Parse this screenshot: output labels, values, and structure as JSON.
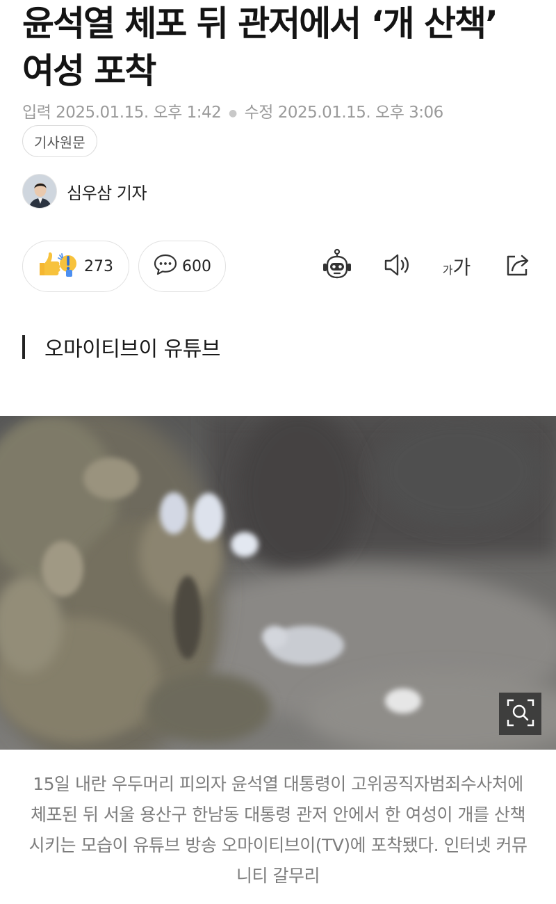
{
  "article": {
    "headline_line1": "윤석열 체포 뒤 관저에서 ‘개 산책’",
    "headline_line2": "여성 포착",
    "input_label": "입력",
    "input_time": "2025.01.15. 오후 1:42",
    "edit_label": "수정",
    "edit_time": "2025.01.15. 오후 3:06",
    "original_button": "기사원문",
    "reporter": "심우삼 기자"
  },
  "actions": {
    "reaction_count": "273",
    "comment_count": "600",
    "font_small": "가",
    "font_large": "가"
  },
  "section": {
    "label": "오마이티브이 유튜브"
  },
  "photo": {
    "caption": "15일 내란 우두머리 피의자 윤석열 대통령이 고위공직자범죄수사처에 체포된 뒤 서울 용산구 한남동 대통령 관저 안에서 한 여성이 개를 산책시키는 모습이 유튜브 방송 오마이티브이(TV)에 포착됐다. 인터넷 커뮤니티 갈무리"
  },
  "icons": {
    "reaction": "thumbs-up-exclaim-icon",
    "comment": "speech-bubble-icon",
    "summary": "robot-icon",
    "listen": "speaker-icon",
    "font_size": "font-size-icon",
    "share": "share-icon",
    "zoom": "zoom-expand-icon"
  },
  "colors": {
    "meta_text": "#9a9a9a",
    "caption_text": "#7d7d7d",
    "reaction_yellow": "#f7c23c",
    "reaction_blue": "#4c8ff0"
  }
}
